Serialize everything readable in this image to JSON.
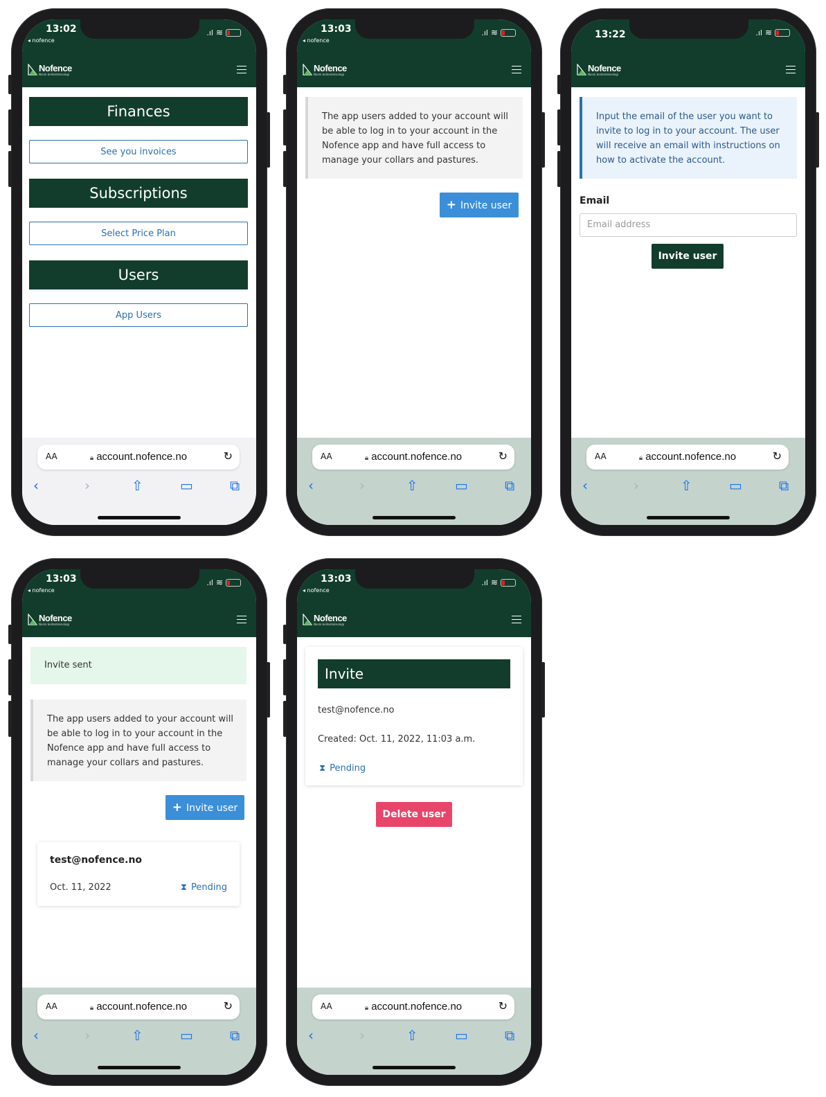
{
  "browser": {
    "url": "account.nofence.no",
    "text_size_label": "AA",
    "lock_icon": "lock-icon",
    "reload_icon": "reload-icon",
    "back_icon": "chevron-left-icon",
    "forward_icon": "chevron-right-icon",
    "share_icon": "share-icon",
    "bookmarks_icon": "book-icon",
    "tabs_icon": "tabs-icon"
  },
  "app": {
    "logo_name": "Nofence",
    "logo_sub": "Norsk beitenteknologi",
    "back_app": "◂ nofence"
  },
  "colors": {
    "brand": "#123d2c",
    "primary": "#3b8fd9",
    "danger": "#e8456a",
    "link": "#2a6fb0"
  },
  "screens": [
    {
      "time": "13:02",
      "sections": [
        {
          "title": "Finances",
          "button": "See you invoices"
        },
        {
          "title": "Subscriptions",
          "button": "Select Price Plan"
        },
        {
          "title": "Users",
          "button": "App Users"
        }
      ]
    },
    {
      "time": "13:03",
      "note": "The app users added to your account will be able to log in to your account in the Nofence app and have full access to manage your collars and pastures.",
      "invite_button": "Invite user"
    },
    {
      "time": "13:22",
      "info": "Input the email of the user you want to invite to log in to your account. The user will receive an email with instructions on how to activate the account.",
      "email_label": "Email",
      "email_placeholder": "Email address",
      "submit_button": "Invite user"
    },
    {
      "time": "13:03",
      "alert": "Invite sent",
      "note": "The app users added to your account will be able to log in to your account in the Nofence app and have full access to manage your collars and pastures.",
      "invite_button": "Invite user",
      "user_card": {
        "email": "test@nofence.no",
        "date": "Oct. 11, 2022",
        "status": "Pending"
      }
    },
    {
      "time": "13:03",
      "invite_title": "Invite",
      "email": "test@nofence.no",
      "created": "Created: Oct. 11, 2022, 11:03 a.m.",
      "status": "Pending",
      "delete_button": "Delete user"
    }
  ]
}
